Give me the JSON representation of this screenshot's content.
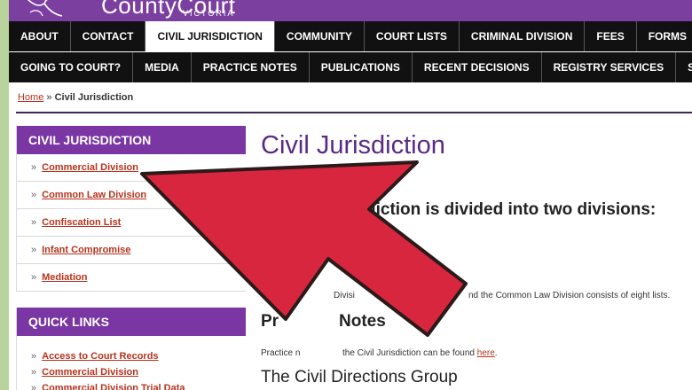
{
  "site": {
    "name": "CountyCourt",
    "subtitle": "VICTORIA"
  },
  "nav": {
    "row1": [
      "ABOUT",
      "CONTACT",
      "CIVIL JURISDICTION",
      "COMMUNITY",
      "COURT LISTS",
      "CRIMINAL DIVISION",
      "FEES",
      "FORMS"
    ],
    "row2": [
      "GOING TO COURT?",
      "MEDIA",
      "PRACTICE NOTES",
      "PUBLICATIONS",
      "RECENT DECISIONS",
      "REGISTRY SERVICES",
      "SECURITY"
    ],
    "active": "CIVIL JURISDICTION"
  },
  "breadcrumb": {
    "home": "Home",
    "separator": "»",
    "current": "Civil Jurisdiction"
  },
  "sidebar": {
    "heading": "CIVIL JURISDICTION",
    "items": [
      "Commercial Division",
      "Common Law Division",
      "Confiscation List",
      "Infant Compromise",
      "Mediation"
    ]
  },
  "quicklinks": {
    "heading": "QUICK LINKS",
    "items": [
      "Access to Court Records",
      "Commercial Division",
      "Commercial Division Trial Data"
    ]
  },
  "main": {
    "title": "Civil Jurisdiction",
    "lead": "diction is divided into two divisions:",
    "para1_left": "Divisi",
    "para1_right": "nd the Common Law Division consists of eight lists.",
    "practice_heading_left": "Pr",
    "practice_heading_right": "Notes",
    "practice_text_left": "Practice n",
    "practice_text_mid": "the Civil Jurisdiction can be found",
    "practice_link": "here",
    "directions_heading": "The Civil Directions Group"
  },
  "colors": {
    "brand_purple": "#7b3fa0",
    "nav_black": "#111111",
    "link_red": "#b8321c",
    "arrow_red": "#d7263d",
    "bg_green": "#b9d39c"
  }
}
